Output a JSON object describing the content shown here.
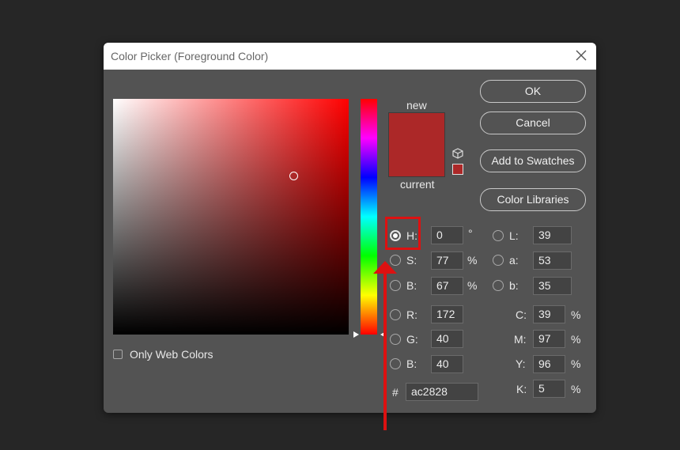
{
  "dialog": {
    "title": "Color Picker (Foreground Color)",
    "only_web_colors_label": "Only Web Colors",
    "only_web_colors_checked": false
  },
  "preview": {
    "new_label": "new",
    "current_label": "current",
    "new_color": "#ac2828",
    "current_color": "#ac2828"
  },
  "buttons": {
    "ok": "OK",
    "cancel": "Cancel",
    "add_to_swatches": "Add to Swatches",
    "color_libraries": "Color Libraries"
  },
  "hsb": {
    "h_label": "H:",
    "h_value": "0",
    "h_unit": "°",
    "s_label": "S:",
    "s_value": "77",
    "s_unit": "%",
    "b_label": "B:",
    "b_value": "67",
    "b_unit": "%"
  },
  "rgb": {
    "r_label": "R:",
    "r_value": "172",
    "g_label": "G:",
    "g_value": "40",
    "b_label": "B:",
    "b_value": "40"
  },
  "lab": {
    "l_label": "L:",
    "l_value": "39",
    "a_label": "a:",
    "a_value": "53",
    "b_label": "b:",
    "b_value": "35"
  },
  "cmyk": {
    "c_label": "C:",
    "c_value": "39",
    "c_unit": "%",
    "m_label": "M:",
    "m_value": "97",
    "m_unit": "%",
    "y_label": "Y:",
    "y_value": "96",
    "y_unit": "%",
    "k_label": "K:",
    "k_value": "5",
    "k_unit": "%"
  },
  "hex": {
    "label": "#",
    "value": "ac2828"
  },
  "selected_mode": "H",
  "annotation_color": "#dd1111"
}
